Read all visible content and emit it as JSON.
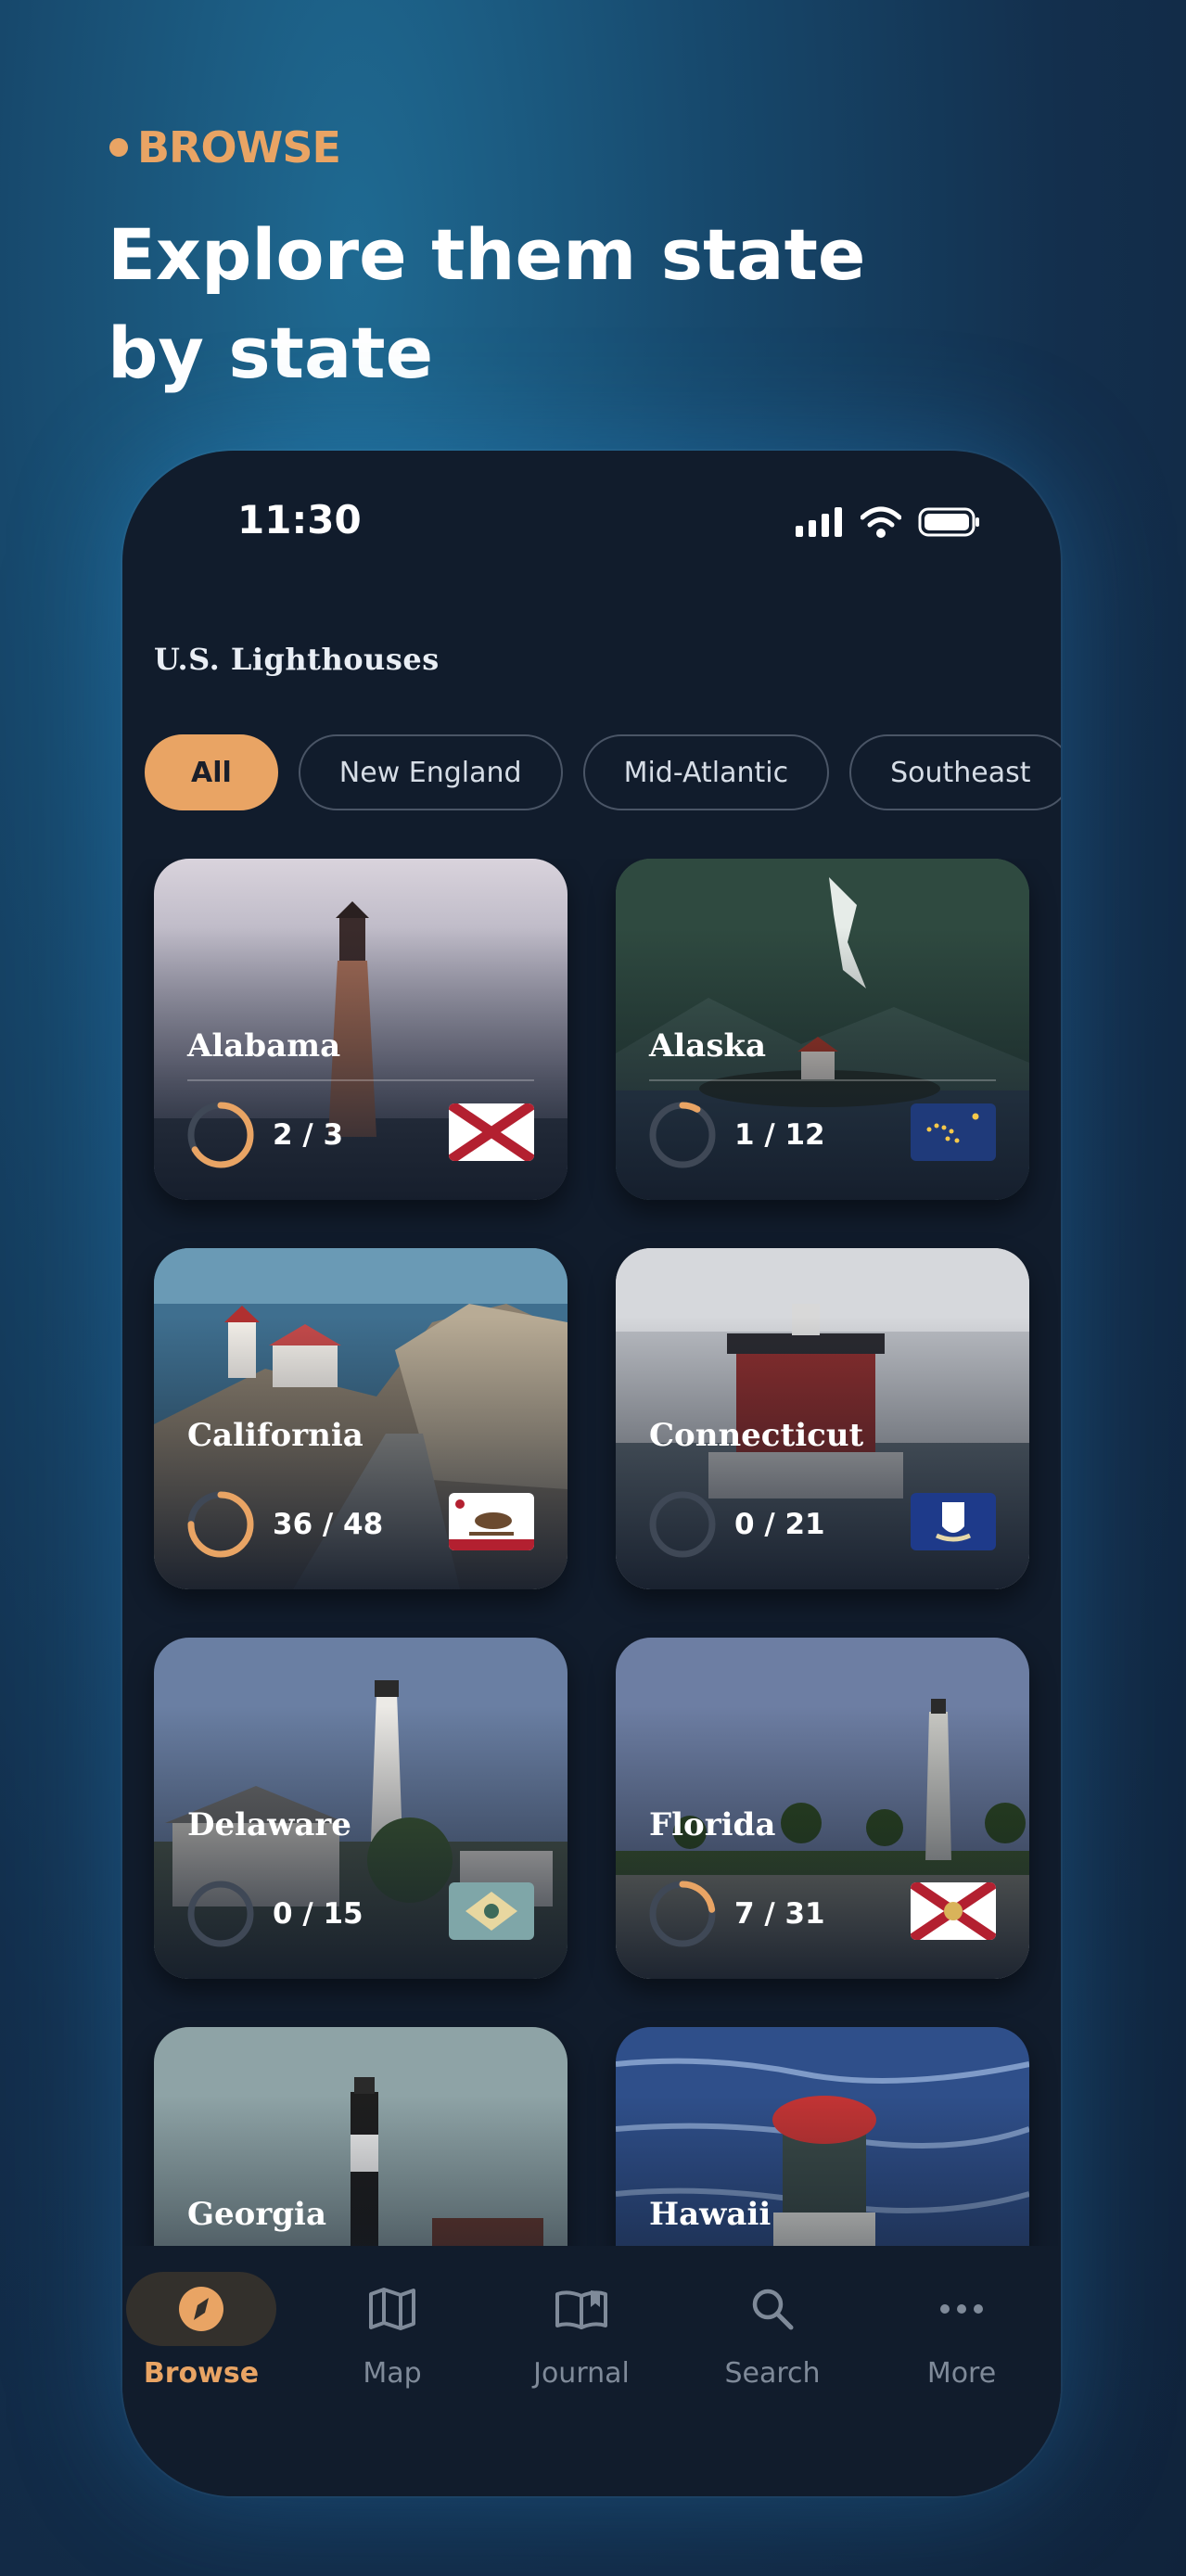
{
  "promo": {
    "eyebrow": "BROWSE",
    "headline": "Explore them state by state"
  },
  "status_bar": {
    "time": "11:30",
    "icons": [
      "signal-icon",
      "wifi-icon",
      "battery-icon"
    ]
  },
  "app": {
    "title": "U.S. Lighthouses"
  },
  "filters": [
    "All",
    "New England",
    "Mid-Atlantic",
    "Southeast"
  ],
  "filters_selected": "All",
  "states": [
    {
      "name": "Alabama",
      "visited": 2,
      "total": 3,
      "count_label": "2 / 3",
      "flag": "alabama-flag"
    },
    {
      "name": "Alaska",
      "visited": 1,
      "total": 12,
      "count_label": "1 / 12",
      "flag": "alaska-flag"
    },
    {
      "name": "California",
      "visited": 36,
      "total": 48,
      "count_label": "36 / 48",
      "flag": "california-flag"
    },
    {
      "name": "Connecticut",
      "visited": 0,
      "total": 21,
      "count_label": "0 / 21",
      "flag": "connecticut-flag"
    },
    {
      "name": "Delaware",
      "visited": 0,
      "total": 15,
      "count_label": "0 / 15",
      "flag": "delaware-flag"
    },
    {
      "name": "Florida",
      "visited": 7,
      "total": 31,
      "count_label": "7 / 31",
      "flag": "florida-flag"
    },
    {
      "name": "Georgia",
      "visited": null,
      "total": null,
      "count_label": "",
      "flag": ""
    },
    {
      "name": "Hawaii",
      "visited": null,
      "total": null,
      "count_label": "",
      "flag": ""
    }
  ],
  "tabs": [
    {
      "label": "Browse",
      "icon": "compass-icon",
      "active": true
    },
    {
      "label": "Map",
      "icon": "map-icon",
      "active": false
    },
    {
      "label": "Journal",
      "icon": "book-icon",
      "active": false
    },
    {
      "label": "Search",
      "icon": "search-icon",
      "active": false
    },
    {
      "label": "More",
      "icon": "more-icon",
      "active": false
    }
  ],
  "colors": {
    "accent": "#e9a464",
    "background": "#111c2c",
    "ring_track": "#3f4856"
  }
}
